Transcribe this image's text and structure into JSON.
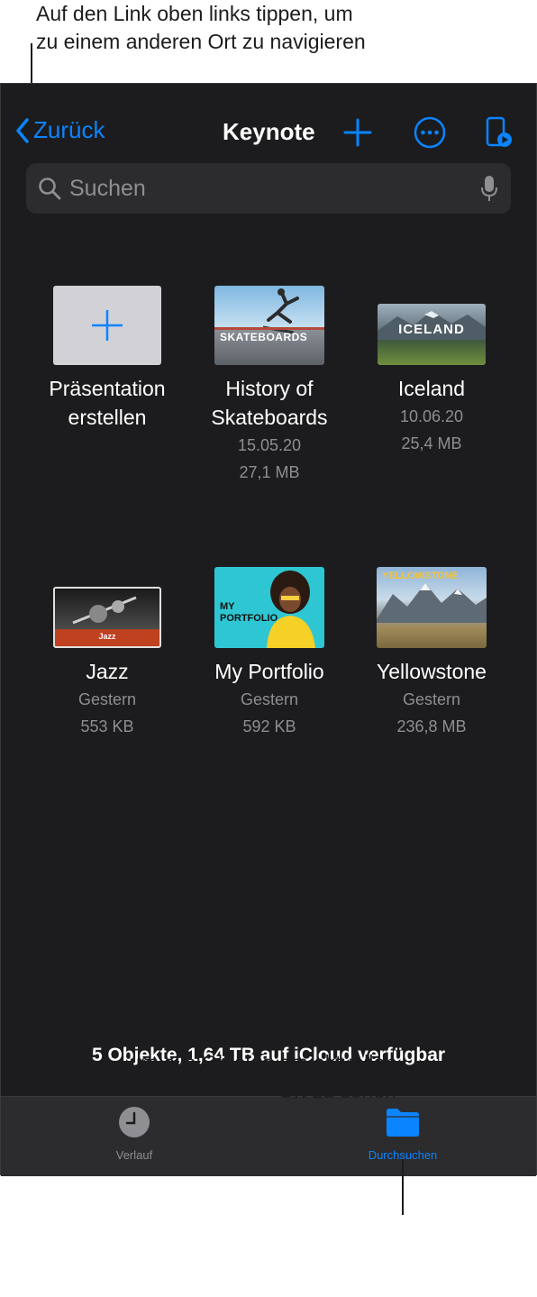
{
  "callouts": {
    "top_line1": "Auf den Link oben links tippen, um",
    "top_line2": "zu einem anderen Ort zu navigieren",
    "bottom_line1": "Auf „Durchsuchen“ tippen,",
    "bottom_line2": "um alle Objekte am aktuellen",
    "bottom_line3": "Ort zu sehen"
  },
  "nav": {
    "back_label": "Zurück",
    "title": "Keynote",
    "icons": [
      "chevron-left-icon",
      "plus-icon",
      "more-icon",
      "present-icon"
    ]
  },
  "search": {
    "placeholder": "Suchen",
    "icons": [
      "search-icon",
      "mic-icon"
    ]
  },
  "items": [
    {
      "title_line1": "Präsentation",
      "title_line2": "erstellen",
      "date": "",
      "size": ""
    },
    {
      "title_line1": "History of",
      "title_line2": "Skateboards",
      "date": "15.05.20",
      "size": "27,1 MB",
      "thumb_text": "SKATEBOARDS"
    },
    {
      "title_line1": "Iceland",
      "title_line2": "",
      "date": "10.06.20",
      "size": "25,4 MB",
      "thumb_text": "ICELAND"
    },
    {
      "title_line1": "Jazz",
      "title_line2": "",
      "date": "Gestern",
      "size": "553 KB",
      "thumb_text": "Jazz"
    },
    {
      "title_line1": "My Portfolio",
      "title_line2": "",
      "date": "Gestern",
      "size": "592 KB",
      "thumb_text": "MY PORTFOLIO"
    },
    {
      "title_line1": "Yellowstone",
      "title_line2": "",
      "date": "Gestern",
      "size": "236,8 MB",
      "thumb_text": "YELLOWSTONE"
    }
  ],
  "status": "5 Objekte, 1,64 TB auf iCloud verfügbar",
  "tabs": [
    {
      "label": "Verlauf",
      "icon": "clock-icon",
      "active": false
    },
    {
      "label": "Durchsuchen",
      "icon": "folder-icon",
      "active": true
    }
  ],
  "colors": {
    "accent": "#0a84ff",
    "background": "#1c1c1e",
    "secondary_text": "#8e8e93"
  }
}
